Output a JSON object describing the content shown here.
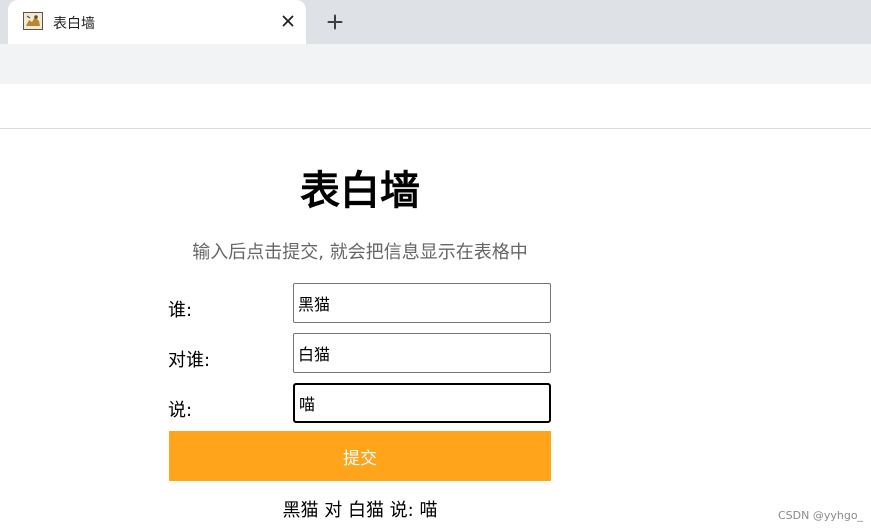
{
  "browser": {
    "tab_title": "表白墙",
    "favicon": "cat-image-icon"
  },
  "page": {
    "title": "表白墙",
    "subtitle": "输入后点击提交, 就会把信息显示在表格中"
  },
  "form": {
    "who_label": "谁:",
    "who_value": "黑猫",
    "to_label": "对谁:",
    "to_value": "白猫",
    "say_label": "说:",
    "say_value": "喵",
    "submit_label": "提交"
  },
  "messages": [
    "黑猫 对 白猫 说: 喵"
  ],
  "watermark": "CSDN @yyhgo_",
  "colors": {
    "accent": "#ffa41b",
    "subtitle": "#666666"
  }
}
